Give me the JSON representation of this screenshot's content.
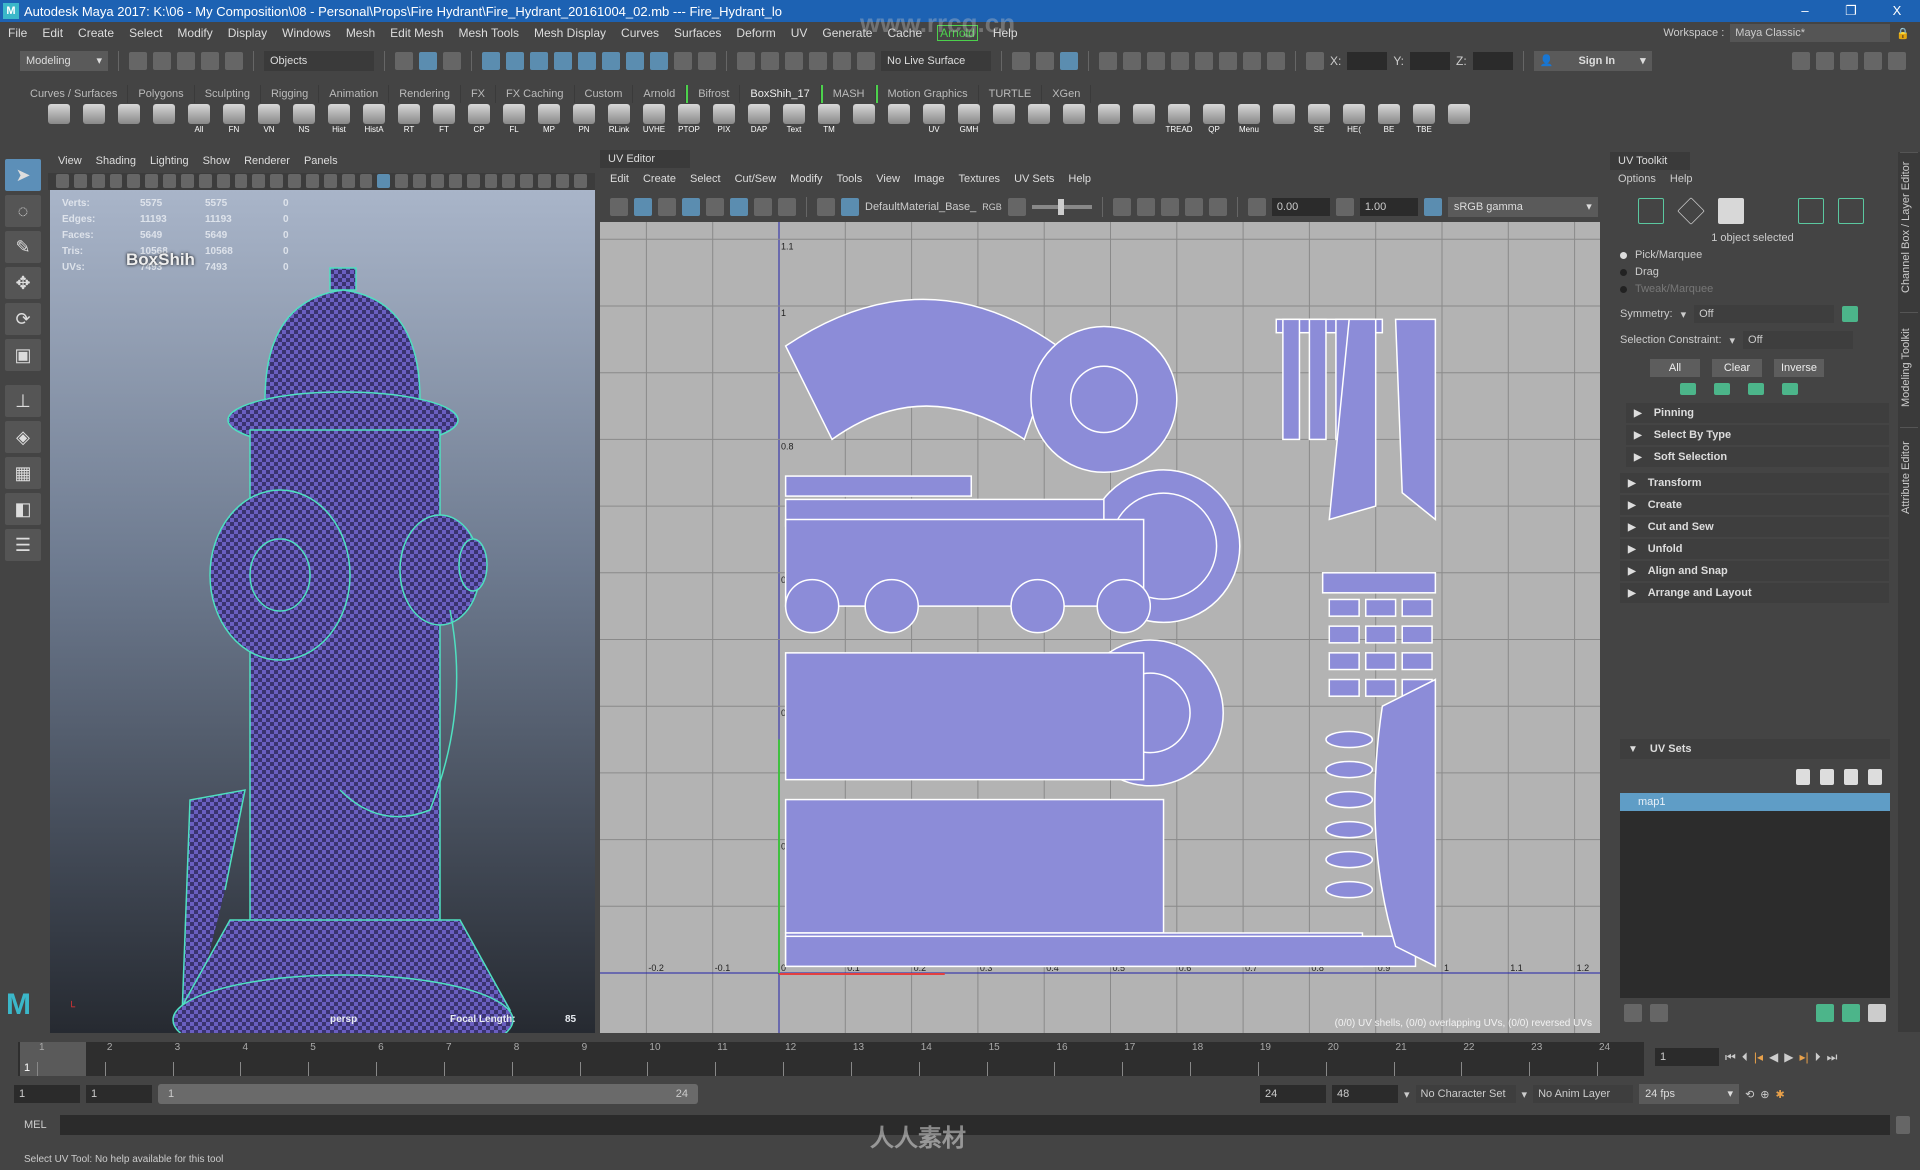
{
  "window": {
    "title": "Autodesk Maya 2017: K:\\06 - My Composition\\08 - Personal\\Props\\Fire Hydrant\\Fire_Hydrant_20161004_02.mb  ---  Fire_Hydrant_lo",
    "app_icon": "M",
    "minimize": "–",
    "restore": "❐",
    "close": "X"
  },
  "menubar": {
    "items": [
      "File",
      "Edit",
      "Create",
      "Select",
      "Modify",
      "Display",
      "Windows",
      "Mesh",
      "Edit Mesh",
      "Mesh Tools",
      "Mesh Display",
      "Curves",
      "Surfaces",
      "Deform",
      "UV",
      "Generate",
      "Cache",
      "Arnold",
      "Help"
    ],
    "workspace_label": "Workspace :",
    "workspace_value": "Maya Classic*"
  },
  "statusline": {
    "mode": "Modeling",
    "objects": "Objects",
    "live_surface": "No Live Surface",
    "x_label": "X:",
    "y_label": "Y:",
    "z_label": "Z:",
    "sign_in": "Sign In"
  },
  "shelf": {
    "tabs": [
      "Curves / Surfaces",
      "Polygons",
      "Sculpting",
      "Rigging",
      "Animation",
      "Rendering",
      "FX",
      "FX Caching",
      "Custom",
      "Arnold",
      "Bifrost",
      "BoxShih_17",
      "MASH",
      "Motion Graphics",
      "TURTLE",
      "XGen"
    ],
    "active_tab": "BoxShih_17",
    "buttons": [
      "",
      "",
      "",
      "",
      "All",
      "FN",
      "VN",
      "NS",
      "Hist",
      "HistA",
      "RT",
      "FT",
      "CP",
      "FL",
      "MP",
      "PN",
      "RLink",
      "UVHE",
      "PTOP",
      "PIX",
      "DAP",
      "Text",
      "TM",
      "",
      "",
      "UV",
      "GMH",
      "",
      "",
      "",
      "",
      "",
      "TREAD",
      "QP",
      "Menu",
      "",
      "SE",
      "HE(",
      "BE",
      "TBE",
      ""
    ]
  },
  "viewport": {
    "menu": [
      "View",
      "Shading",
      "Lighting",
      "Show",
      "Renderer",
      "Panels"
    ],
    "hud": [
      {
        "label": "Verts:",
        "a": "5575",
        "b": "5575",
        "c": "0"
      },
      {
        "label": "Edges:",
        "a": "11193",
        "b": "11193",
        "c": "0"
      },
      {
        "label": "Faces:",
        "a": "5649",
        "b": "5649",
        "c": "0"
      },
      {
        "label": "Tris:",
        "a": "10568",
        "b": "10568",
        "c": "0"
      },
      {
        "label": "UVs:",
        "a": "7493",
        "b": "7493",
        "c": "0"
      }
    ],
    "watermark_name": "BoxShih",
    "camera": "persp",
    "focal_label": "Focal Length:",
    "focal_value": "85"
  },
  "uv_editor": {
    "tab": "UV Editor",
    "menu": [
      "Edit",
      "Create",
      "Select",
      "Cut/Sew",
      "Modify",
      "Tools",
      "View",
      "Image",
      "Textures",
      "UV Sets",
      "Help"
    ],
    "material": "DefaultMaterial_Base_",
    "rgb": "RGB",
    "exposure": "0.00",
    "gamma": "1.00",
    "colorspace": "sRGB gamma",
    "u_ticks": [
      "-0.2",
      "-0.1",
      "0",
      "0.1",
      "0.2",
      "0.3",
      "0.4",
      "0.5",
      "0.6",
      "0.7",
      "0.8",
      "0.9",
      "1",
      "1.1",
      "1.2"
    ],
    "v_ticks": [
      "0",
      "0.2",
      "0.4",
      "0.6",
      "0.8",
      "1",
      "1.1"
    ],
    "status": "(0/0) UV shells, (0/0) overlapping UVs, (0/0) reversed UVs",
    "shell_color": "#8c8cd8"
  },
  "uv_toolkit": {
    "title": "UV Toolkit",
    "menu": [
      "Options",
      "Help"
    ],
    "selection_info": "1 object selected",
    "modes": [
      "Pick/Marquee",
      "Drag",
      "Tweak/Marquee"
    ],
    "active_mode": "Pick/Marquee",
    "symmetry_label": "Symmetry:",
    "symmetry_value": "Off",
    "constraint_label": "Selection Constraint:",
    "constraint_value": "Off",
    "buttons": [
      "All",
      "Clear",
      "Inverse"
    ],
    "rollouts_a": [
      "Pinning",
      "Select By Type",
      "Soft Selection"
    ],
    "rollouts_b": [
      "Transform",
      "Create",
      "Cut and Sew",
      "Unfold",
      "Align and Snap",
      "Arrange and Layout"
    ],
    "uv_sets_title": "UV Sets",
    "uv_sets": [
      "map1"
    ]
  },
  "side_tabs": [
    "Channel Box / Layer Editor",
    "Modeling Toolkit",
    "Attribute Editor"
  ],
  "timeline": {
    "ticks": [
      "1",
      "2",
      "3",
      "4",
      "5",
      "6",
      "7",
      "8",
      "9",
      "10",
      "11",
      "12",
      "13",
      "14",
      "15",
      "16",
      "17",
      "18",
      "19",
      "20",
      "21",
      "22",
      "23",
      "24"
    ],
    "current_frame": "1",
    "current_field": "1"
  },
  "range": {
    "start": "1",
    "anim_start": "1",
    "slider_start": "1",
    "slider_end": "24",
    "end": "24",
    "anim_end": "48",
    "character_set": "No Character Set",
    "anim_layer": "No Anim Layer",
    "fps": "24 fps"
  },
  "command": {
    "label": "MEL"
  },
  "help_line": "Select UV Tool: No help available for this tool",
  "watermarks": {
    "site": "www.rrcg.cn",
    "brand": "人人素材"
  }
}
